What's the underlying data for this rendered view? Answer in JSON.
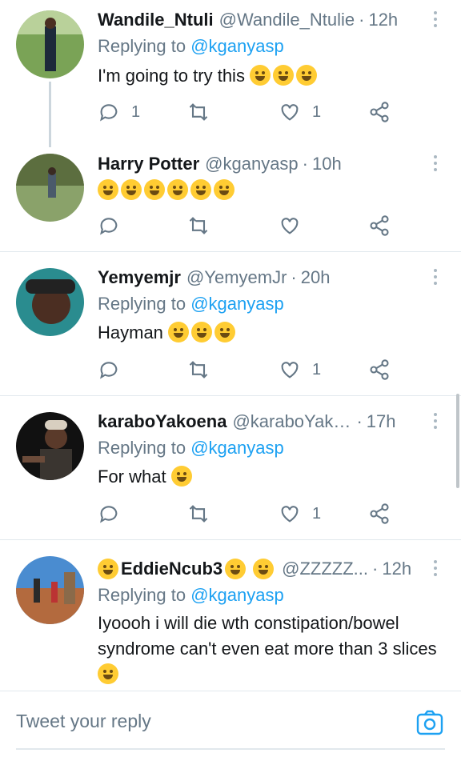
{
  "tweets": [
    {
      "name": "Wandile_Ntuli",
      "handle": "@Wandile_Ntulie",
      "time": "12h",
      "replying_label": "Replying to",
      "replying_to": "@kganyasp",
      "text": "I'm going to try this",
      "emoji": [
        "joy-emoji",
        "joy-emoji",
        "sob-emoji"
      ],
      "reply_count": "1",
      "like_count": "1"
    },
    {
      "name": "Harry Potter",
      "handle": "@kganyasp",
      "time": "10h",
      "text": "",
      "emoji": [
        "joy-emoji",
        "joy-emoji",
        "joy-emoji",
        "joy-emoji",
        "joy-emoji",
        "raised-hands-emoji"
      ],
      "reply_count": "",
      "like_count": ""
    },
    {
      "name": "Yemyemjr",
      "handle": "@YemyemJr",
      "time": "20h",
      "replying_label": "Replying to",
      "replying_to": "@kganyasp",
      "text": "Hayman",
      "emoji": [
        "joy-emoji",
        "rofl-emoji",
        "rofl-emoji"
      ],
      "reply_count": "",
      "like_count": "1"
    },
    {
      "name": "karaboYakoena",
      "handle": "@karaboYako...",
      "time": "17h",
      "replying_label": "Replying to",
      "replying_to": "@kganyasp",
      "text": "For what",
      "emoji": [
        "smile-emoji"
      ],
      "reply_count": "",
      "like_count": "1"
    },
    {
      "name": "EddieNcub3",
      "handle": "@ZZZZZ...",
      "time": "12h",
      "replying_label": "Replying to",
      "replying_to": "@kganyasp",
      "text": "Iyoooh i will die wth constipation/bowel syndrome can't even eat more than 3 slices",
      "emoji": [
        "person-gesturing-no-emoji"
      ],
      "name_emoji": [
        "dizzy-emoji",
        "ok-hand-emoji",
        "wink-emoji"
      ]
    }
  ],
  "compose": {
    "placeholder": "Tweet your reply"
  },
  "dot_separator": "·",
  "colors": {
    "accent": "#1da1f2",
    "muted": "#657786",
    "divider": "#e1e8ed"
  }
}
